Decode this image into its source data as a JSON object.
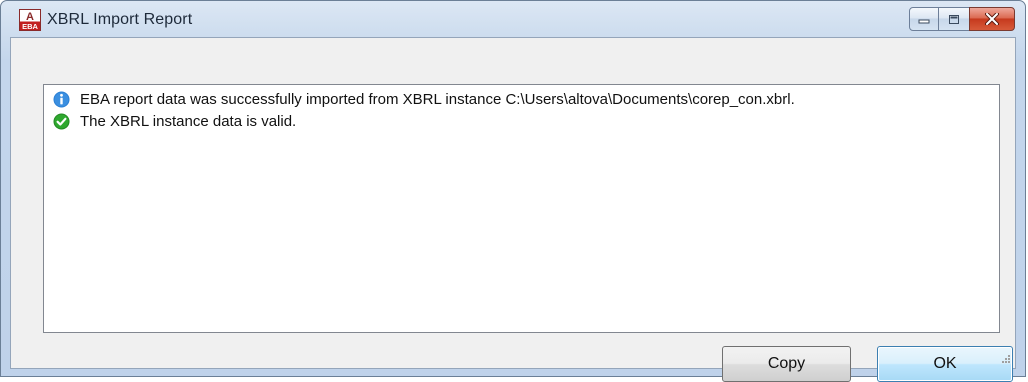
{
  "window": {
    "title": "XBRL Import Report",
    "app_icon_text_top": "A",
    "app_icon_text_bottom": "EBA"
  },
  "caption_buttons": {
    "minimize": "minimize-icon",
    "maximize": "maximize-icon",
    "close": "close-icon"
  },
  "report": {
    "messages": [
      {
        "icon": "info-icon",
        "text": "EBA report data was successfully imported from XBRL instance C:\\Users\\altova\\Documents\\corep_con.xbrl."
      },
      {
        "icon": "check-icon",
        "text": "The XBRL instance data is valid."
      }
    ]
  },
  "buttons": {
    "copy_label": "Copy",
    "ok_label": "OK"
  },
  "colors": {
    "info": "#2a7fd4",
    "success": "#2fa82f",
    "close_button": "#c63a1e"
  }
}
